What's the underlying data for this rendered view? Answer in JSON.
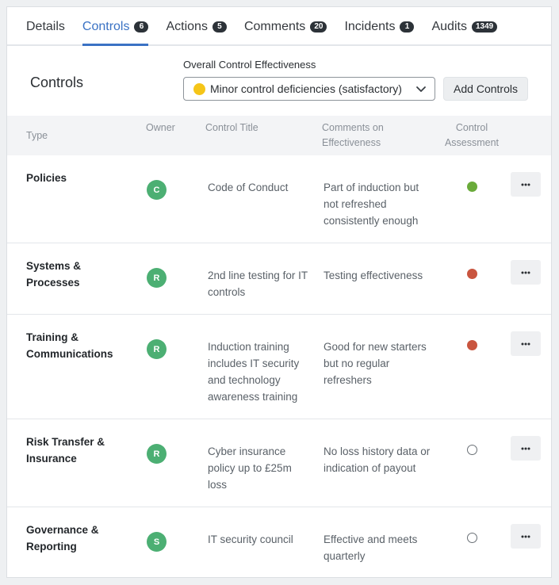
{
  "tabs": [
    {
      "label": "Details",
      "count": ""
    },
    {
      "label": "Controls",
      "count": "6"
    },
    {
      "label": "Actions",
      "count": "5"
    },
    {
      "label": "Comments",
      "count": "20"
    },
    {
      "label": "Incidents",
      "count": "1"
    },
    {
      "label": "Audits",
      "count": "1349"
    }
  ],
  "active_tab": "Controls",
  "header": {
    "title": "Controls",
    "effectiveness_label": "Overall Control Effectiveness",
    "effectiveness_value": "Minor control deficiencies (satisfactory)",
    "effectiveness_color": "#f5c518",
    "add_button": "Add Controls"
  },
  "columns": {
    "type": "Type",
    "owner": "Owner",
    "title": "Control Title",
    "comments_line1": "Comments on",
    "comments_line2": "Effectiveness",
    "assessment_line1": "Control",
    "assessment_line2": "Assessment"
  },
  "rows": [
    {
      "type_line1": "Policies",
      "type_line2": "",
      "owner": "C",
      "title": "Code of Conduct",
      "comment": "Part of induction but not refreshed consistently enough",
      "assessment": "green"
    },
    {
      "type_line1": "Systems &",
      "type_line2": "Processes",
      "owner": "R",
      "title": "2nd line testing for IT controls",
      "comment": "Testing effectiveness",
      "assessment": "red"
    },
    {
      "type_line1": "Training &",
      "type_line2": "Communications",
      "owner": "R",
      "title": "Induction training includes IT security and technology awareness training",
      "comment": "Good for new starters but no regular refreshers",
      "assessment": "red"
    },
    {
      "type_line1": "Risk Transfer &",
      "type_line2": "Insurance",
      "owner": "R",
      "title": "Cyber insurance policy up to £25m loss",
      "comment": "No loss history data or indication of payout",
      "assessment": "none"
    },
    {
      "type_line1": "Governance &",
      "type_line2": "Reporting",
      "owner": "S",
      "title": "IT security council",
      "comment": "Effective and meets quarterly",
      "assessment": "none"
    }
  ],
  "colors": {
    "accent": "#3a72c4",
    "avatar": "#4caf73",
    "assessment_green": "#6aab3a",
    "assessment_red": "#c9553f"
  },
  "icons": {
    "select_caret": "chevron-down-icon",
    "row_menu": "more-horizontal-icon"
  }
}
